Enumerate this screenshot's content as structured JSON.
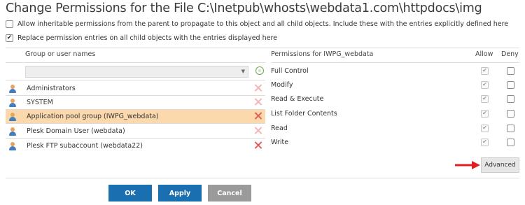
{
  "title": "Change Permissions for the File C:\\Inetpub\\whosts\\webdata1.com\\httpdocs\\img",
  "options": {
    "inherit": {
      "label": "Allow inheritable permissions from the parent to propagate to this object and all child objects. Include these with the entries explicitly defined here",
      "checked": false
    },
    "replace": {
      "label": "Replace permission entries on all child objects with the entries displayed here",
      "checked": true
    }
  },
  "users_panel": {
    "header": "Group or user names",
    "users": [
      {
        "name": "Administrators",
        "selected": false
      },
      {
        "name": "SYSTEM",
        "selected": false
      },
      {
        "name": "Application pool group (IWPG_webdata)",
        "selected": true
      },
      {
        "name": "Plesk Domain User (webdata)",
        "selected": false
      },
      {
        "name": "Plesk FTP subaccount (webdata22)",
        "selected": false
      }
    ]
  },
  "permissions_panel": {
    "header": "Permissions for IWPG_webdata",
    "allow_header": "Allow",
    "deny_header": "Deny",
    "permissions": [
      {
        "name": "Full Control",
        "allow": true,
        "deny": false
      },
      {
        "name": "Modify",
        "allow": true,
        "deny": false
      },
      {
        "name": "Read & Execute",
        "allow": true,
        "deny": false
      },
      {
        "name": "List Folder Contents",
        "allow": true,
        "deny": false
      },
      {
        "name": "Read",
        "allow": true,
        "deny": false
      },
      {
        "name": "Write",
        "allow": true,
        "deny": false
      }
    ]
  },
  "advanced_label": "Advanced",
  "buttons": {
    "ok": "OK",
    "apply": "Apply",
    "cancel": "Cancel"
  },
  "colors": {
    "primary_button": "#1a6fb0",
    "cancel_button": "#9a9a9a",
    "selected_row": "#fbd9ad",
    "delete_icon": "#e55b5b",
    "arrow": "#e02020"
  }
}
